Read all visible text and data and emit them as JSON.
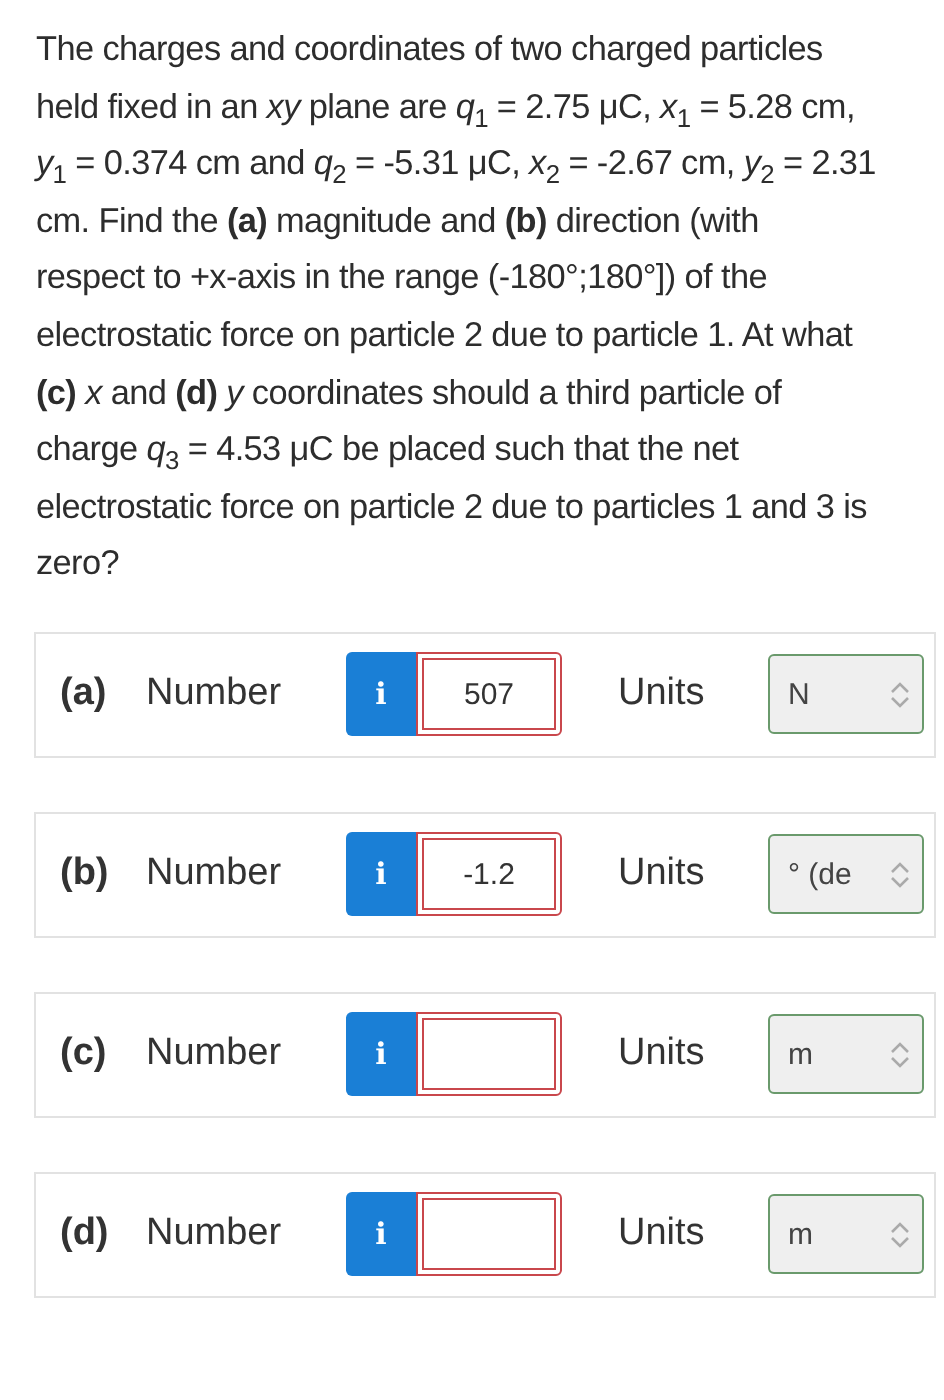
{
  "question": "The charges and coordinates of two charged particles held fixed in an *xy* plane are *q*$_{1}$ = 2.75 μC, *x*$_{1}$ = 5.28 cm, *y*$_{1}$ = 0.374 cm and *q*$_{2}$ = -5.31 μC, *x*$_{2}$ = -2.67 cm, *y*$_{2}$ = 2.31 cm. Find the **(a)** magnitude and **(b)** direction (with respect to +x-axis in the range (-180°;180°]) of the electrostatic force on particle 2 due to particle 1. At what **(c)** *x* and **(d)** *y* coordinates should a third particle of charge *q*$_{3}$ = 4.53 μC be placed such that the net electrostatic force on particle 2 due to particles 1 and 3 is zero?",
  "answers": [
    {
      "part": "(a)",
      "label": "Number",
      "info": "i",
      "value": "507",
      "units_label": "Units",
      "unit": "N"
    },
    {
      "part": "(b)",
      "label": "Number",
      "info": "i",
      "value": "-1.2",
      "units_label": "Units",
      "unit": "° (de"
    },
    {
      "part": "(c)",
      "label": "Number",
      "info": "i",
      "units_label": "Units",
      "unit": "m"
    },
    {
      "part": "(d)",
      "label": "Number",
      "info": "i",
      "units_label": "Units",
      "unit": "m"
    }
  ]
}
